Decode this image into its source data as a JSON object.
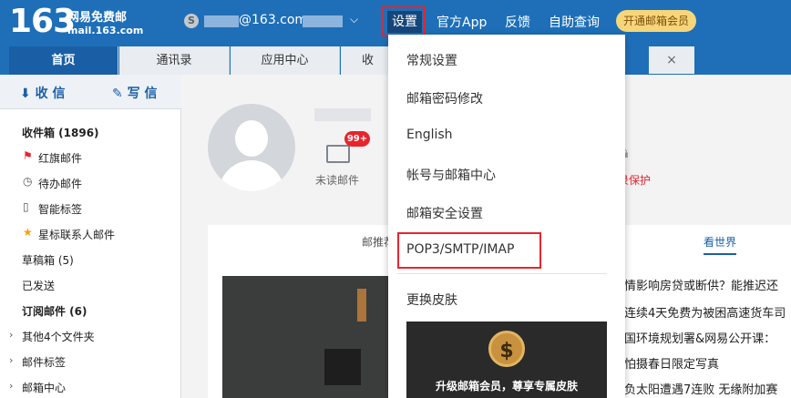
{
  "header": {
    "logo_number": "163",
    "logo_name": "网易免费邮",
    "logo_domain": "mail.163.com",
    "account_suffix": "@163.com",
    "nav": [
      "设置",
      "官方App",
      "反馈",
      "自助查询"
    ],
    "vip_label": "开通邮箱会员"
  },
  "tabs": [
    "首页",
    "通讯录",
    "应用中心",
    "收"
  ],
  "sidebar": {
    "receive_label": "收 信",
    "write_label": "写 信",
    "items": [
      {
        "label": "收件箱 (1896)"
      },
      {
        "label": "红旗邮件"
      },
      {
        "label": "待办邮件"
      },
      {
        "label": "智能标签"
      },
      {
        "label": "星标联系人邮件"
      },
      {
        "label": "草稿箱 (5)"
      },
      {
        "label": "已发送"
      },
      {
        "label": "订阅邮件 (6)"
      },
      {
        "label": "其他4个文件夹"
      },
      {
        "label": "邮件标签"
      },
      {
        "label": "邮箱中心"
      }
    ]
  },
  "profile": {
    "unread_badge": "99+",
    "unread_label": "未读邮件",
    "protect_label": "录保护"
  },
  "news": {
    "tab1": "邮推荐",
    "tab2": "看世界",
    "headlines": [
      "情影响房贷或断供？能推迟还",
      "连续4天免费为被困高速货车司",
      "国环境规划署&网易公开课：",
      "怕摄春日限定写真",
      "负太阳遭遇7连败 无缘附加赛"
    ]
  },
  "settings_menu": {
    "items": [
      "常规设置",
      "邮箱密码修改",
      "English",
      "帐号与邮箱中心",
      "邮箱安全设置",
      "POP3/SMTP/IMAP",
      "更换皮肤"
    ],
    "skin_caption": "升级邮箱会员，尊享专属皮肤"
  },
  "colors": {
    "brand_blue": "#1e6fb8",
    "highlight_red": "#e8242c",
    "vip_gold": "#f7d67a"
  }
}
